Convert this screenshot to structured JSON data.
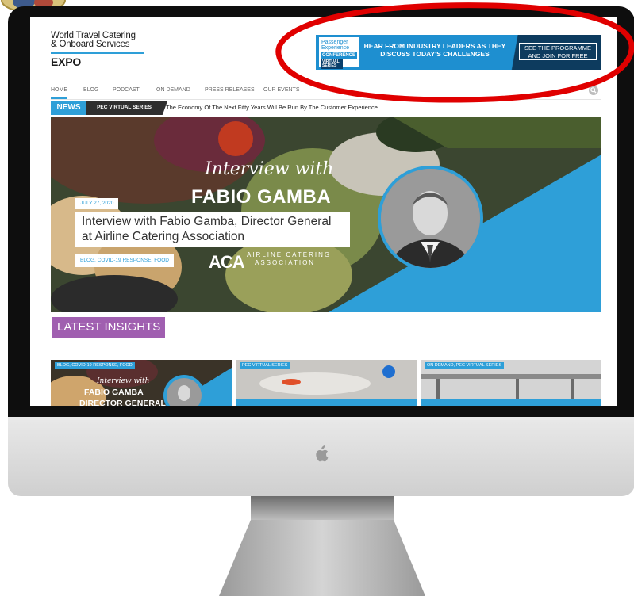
{
  "site": {
    "logo_line1": "World Travel Catering",
    "logo_line2": "& Onboard Services",
    "logo_line3": "EXPO"
  },
  "ad": {
    "logo_line1": "Passenger",
    "logo_line2": "Experience",
    "logo_line3": "CONFERENCE",
    "logo_line4": "VIRTUAL SERIES",
    "text_line1": "HEAR FROM INDUSTRY LEADERS AS THEY",
    "text_line2": "DISCUSS TODAY'S CHALLENGES",
    "cta_line1": "SEE THE PROGRAMME",
    "cta_line2": "AND JOIN FOR FREE",
    "accent": "#1e8fd0"
  },
  "nav": {
    "items": [
      "HOME",
      "BLOG",
      "PODCAST",
      "ON DEMAND",
      "PRESS RELEASES",
      "OUR EVENTS"
    ],
    "active": "HOME"
  },
  "ticker": {
    "label": "NEWS",
    "category": "PEC VIRTUAL SERIES",
    "headline": "The Economy Of The Next Fifty Years Will Be Run By The Customer Experience"
  },
  "hero": {
    "script_text": "Interview with",
    "name_text": "FABIO GAMBA",
    "date": "JULY 27, 2020",
    "title": "Interview with Fabio Gamba, Director General at Airline Catering Association",
    "categories": "BLOG, COVID-19 RESPONSE, FOOD",
    "aca_mark": "ACA",
    "aca_line1": "AIRLINE CATERING",
    "aca_line2": "ASSOCIATION"
  },
  "latest": {
    "heading": "LATEST INSIGHTS"
  },
  "cards": [
    {
      "tag": "BLOG, COVID-19 RESPONSE, FOOD",
      "script": "Interview with",
      "name": "FABIO GAMBA",
      "sub": "DIRECTOR GENERAL"
    },
    {
      "tag": "PEC VIRTUAL SERIES"
    },
    {
      "tag": "ON DEMAND, PEC VIRTUAL SERIES"
    }
  ],
  "colors": {
    "brand_blue": "#2e9fd8",
    "latest_purple": "#a05fb0",
    "annotation_red": "#e00000",
    "bezel": "#0e0e0e"
  },
  "icons": {
    "search": "search-icon",
    "apple": "apple-logo-icon"
  }
}
